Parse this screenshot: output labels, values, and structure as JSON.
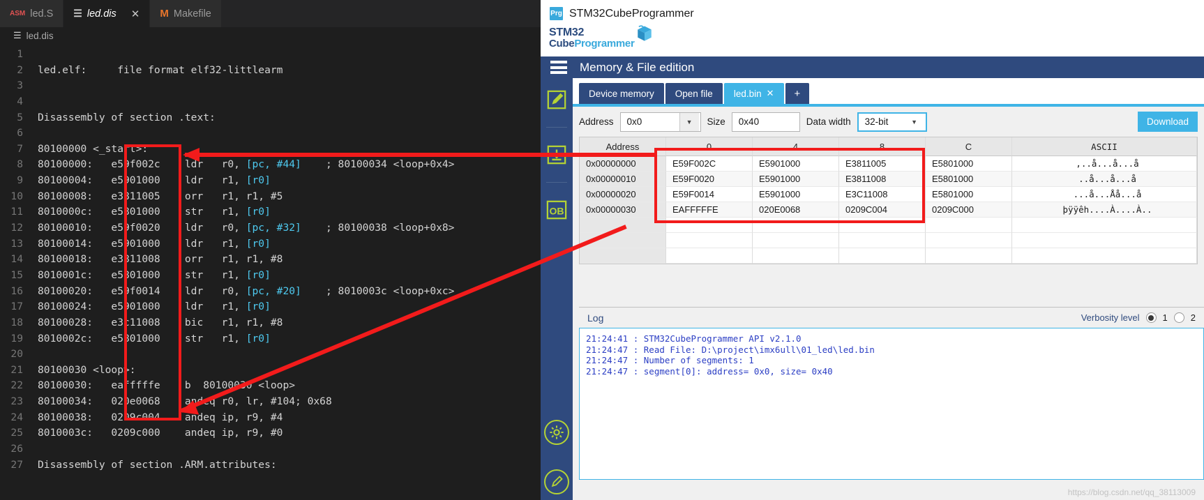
{
  "editor": {
    "tabs": [
      {
        "label": "led.S",
        "icon": "asm-file-icon",
        "active": false,
        "closable": false
      },
      {
        "label": "led.dis",
        "icon": "disassembly-file-icon",
        "active": true,
        "closable": true
      },
      {
        "label": "Makefile",
        "icon": "makefile-icon",
        "active": false,
        "closable": false
      }
    ],
    "close_glyph": "✕",
    "breadcrumb": "led.dis",
    "breadcrumb_icon": "☰",
    "lines": [
      {
        "n": "1",
        "text": ""
      },
      {
        "n": "2",
        "text": "led.elf:     file format elf32-littlearm"
      },
      {
        "n": "3",
        "text": ""
      },
      {
        "n": "4",
        "text": ""
      },
      {
        "n": "5",
        "text": "Disassembly of section .text:"
      },
      {
        "n": "6",
        "text": ""
      },
      {
        "n": "7",
        "text": "80100000 <_start>:"
      },
      {
        "n": "8",
        "text": "80100000:\te59f002c\tldr\tr0, [pc, #44]\t; 80100034 <loop+0x4>"
      },
      {
        "n": "9",
        "text": "80100004:\te5901000\tldr\tr1, [r0]"
      },
      {
        "n": "10",
        "text": "80100008:\te3811005\torr\tr1, r1, #5"
      },
      {
        "n": "11",
        "text": "8010000c:\te5801000\tstr\tr1, [r0]"
      },
      {
        "n": "12",
        "text": "80100010:\te59f0020\tldr\tr0, [pc, #32]\t; 80100038 <loop+0x8>"
      },
      {
        "n": "13",
        "text": "80100014:\te5901000\tldr\tr1, [r0]"
      },
      {
        "n": "14",
        "text": "80100018:\te3811008\torr\tr1, r1, #8"
      },
      {
        "n": "15",
        "text": "8010001c:\te5801000\tstr\tr1, [r0]"
      },
      {
        "n": "16",
        "text": "80100020:\te59f0014\tldr\tr0, [pc, #20]\t; 8010003c <loop+0xc>"
      },
      {
        "n": "17",
        "text": "80100024:\te5901000\tldr\tr1, [r0]"
      },
      {
        "n": "18",
        "text": "80100028:\te3c11008\tbic\tr1, r1, #8"
      },
      {
        "n": "19",
        "text": "8010002c:\te5801000\tstr\tr1, [r0]"
      },
      {
        "n": "20",
        "text": ""
      },
      {
        "n": "21",
        "text": "80100030 <loop>:"
      },
      {
        "n": "22",
        "text": "80100030:\teafffffe\tb  80100030 <loop>"
      },
      {
        "n": "23",
        "text": "80100034:\t020e0068\tandeq r0, lr, #104\t; 0x68"
      },
      {
        "n": "24",
        "text": "80100038:\t0209c004\tandeq ip, r9, #4"
      },
      {
        "n": "25",
        "text": "8010003c:\t0209c000\tandeq ip, r9, #0"
      },
      {
        "n": "26",
        "text": ""
      },
      {
        "n": "27",
        "text": "Disassembly of section .ARM.attributes:"
      }
    ]
  },
  "stm32": {
    "window_title": "STM32CubeProgrammer",
    "window_badge": "Prg",
    "logo_line1": "STM32",
    "logo_line2_a": "Cube",
    "logo_line2_b": "Programmer",
    "menu_title": "Memory & File edition",
    "sidebar_icons": [
      "edit-pencil-icon",
      "download-icon",
      "option-bytes-icon",
      "settings-gear-icon",
      "info-pen-icon"
    ],
    "option_bytes_label": "OB",
    "tabs": [
      {
        "label": "Device memory",
        "selected": false,
        "closable": false
      },
      {
        "label": "Open file",
        "selected": false,
        "closable": false
      },
      {
        "label": "led.bin",
        "selected": true,
        "closable": true
      },
      {
        "label": "+",
        "selected": false,
        "closable": false
      }
    ],
    "tab_close_glyph": "✕",
    "controls": {
      "address_label": "Address",
      "address_value": "0x0",
      "size_label": "Size",
      "size_value": "0x40",
      "data_width_label": "Data width",
      "data_width_value": "32-bit",
      "download_label": "Download",
      "dropdown_glyph": "▼"
    },
    "table": {
      "headers": [
        "Address",
        "0",
        "4",
        "8",
        "C",
        "ASCII"
      ],
      "rows": [
        {
          "address": "0x00000000",
          "words": [
            "E59F002C",
            "E5901000",
            "E3811005",
            "E5801000"
          ],
          "ascii": ",..å...å...å"
        },
        {
          "address": "0x00000010",
          "words": [
            "E59F0020",
            "E5901000",
            "E3811008",
            "E5801000"
          ],
          "ascii": " ..å...å...å"
        },
        {
          "address": "0x00000020",
          "words": [
            "E59F0014",
            "E5901000",
            "E3C11008",
            "E5801000"
          ],
          "ascii": "...å...Åå...å"
        },
        {
          "address": "0x00000030",
          "words": [
            "EAFFFFFE",
            "020E0068",
            "0209C004",
            "0209C000"
          ],
          "ascii": "þÿÿêh....À....À.."
        }
      ],
      "blank_rows": 3
    },
    "log": {
      "label": "Log",
      "verbosity_label": "Verbosity level",
      "levels": [
        {
          "value": "1",
          "selected": true
        },
        {
          "value": "2",
          "selected": false
        }
      ],
      "lines": [
        "21:24:41 : STM32CubeProgrammer API v2.1.0",
        "21:24:47 : Read File: D:\\project\\imx6ull\\01_led\\led.bin",
        "21:24:47 : Number of segments: 1",
        "21:24:47 : segment[0]: address= 0x0, size= 0x40"
      ]
    },
    "watermark": "https://blog.csdn.net/qq_38113009"
  },
  "annotations": {
    "colors": {
      "highlight_red": "#f21b1b",
      "accent_blue": "#3fb4e6",
      "navy": "#2f4a7e",
      "lime": "#b5d334"
    },
    "boxes": [
      {
        "name": "code-opcode-column-box"
      },
      {
        "name": "hex-data-box"
      }
    ],
    "arrows": [
      {
        "name": "arrow-hex-to-code-top"
      },
      {
        "name": "arrow-hex-to-code-bottom"
      }
    ]
  }
}
